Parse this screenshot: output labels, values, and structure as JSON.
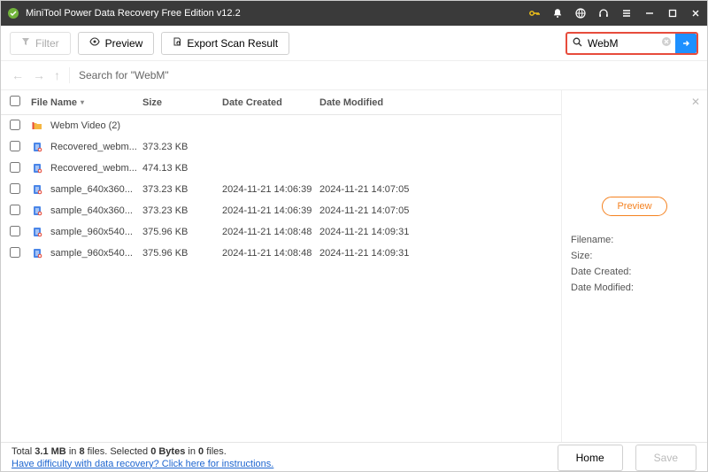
{
  "title": "MiniTool Power Data Recovery Free Edition v12.2",
  "toolbar": {
    "filter": "Filter",
    "preview": "Preview",
    "export": "Export Scan Result"
  },
  "search": {
    "value": "WebM"
  },
  "nav": {
    "search_text": "Search for  \"WebM\""
  },
  "columns": {
    "name": "File Name",
    "size": "Size",
    "created": "Date Created",
    "modified": "Date Modified"
  },
  "rows": [
    {
      "name": "Webm Video (2)",
      "kind": "folder",
      "size": "",
      "created": "",
      "modified": ""
    },
    {
      "name": "Recovered_webm...",
      "kind": "file",
      "size": "373.23 KB",
      "created": "",
      "modified": ""
    },
    {
      "name": "Recovered_webm...",
      "kind": "file",
      "size": "474.13 KB",
      "created": "",
      "modified": ""
    },
    {
      "name": "sample_640x360...",
      "kind": "file",
      "size": "373.23 KB",
      "created": "2024-11-21 14:06:39",
      "modified": "2024-11-21 14:07:05"
    },
    {
      "name": "sample_640x360...",
      "kind": "file",
      "size": "373.23 KB",
      "created": "2024-11-21 14:06:39",
      "modified": "2024-11-21 14:07:05"
    },
    {
      "name": "sample_960x540...",
      "kind": "file",
      "size": "375.96 KB",
      "created": "2024-11-21 14:08:48",
      "modified": "2024-11-21 14:09:31"
    },
    {
      "name": "sample_960x540...",
      "kind": "file",
      "size": "375.96 KB",
      "created": "2024-11-21 14:08:48",
      "modified": "2024-11-21 14:09:31"
    }
  ],
  "side": {
    "preview_btn": "Preview",
    "filename_label": "Filename:",
    "size_label": "Size:",
    "created_label": "Date Created:",
    "modified_label": "Date Modified:"
  },
  "footer": {
    "total_prefix": "Total ",
    "total_size": "3.1 MB",
    "total_mid": " in ",
    "total_files": "8",
    "total_suffix": " files. ",
    "selected_prefix": "Selected ",
    "selected_bytes": "0 Bytes",
    "selected_mid": " in ",
    "selected_files": "0",
    "selected_suffix": " files.",
    "help": "Have difficulty with data recovery? Click here for instructions.",
    "home": "Home",
    "save": "Save"
  }
}
